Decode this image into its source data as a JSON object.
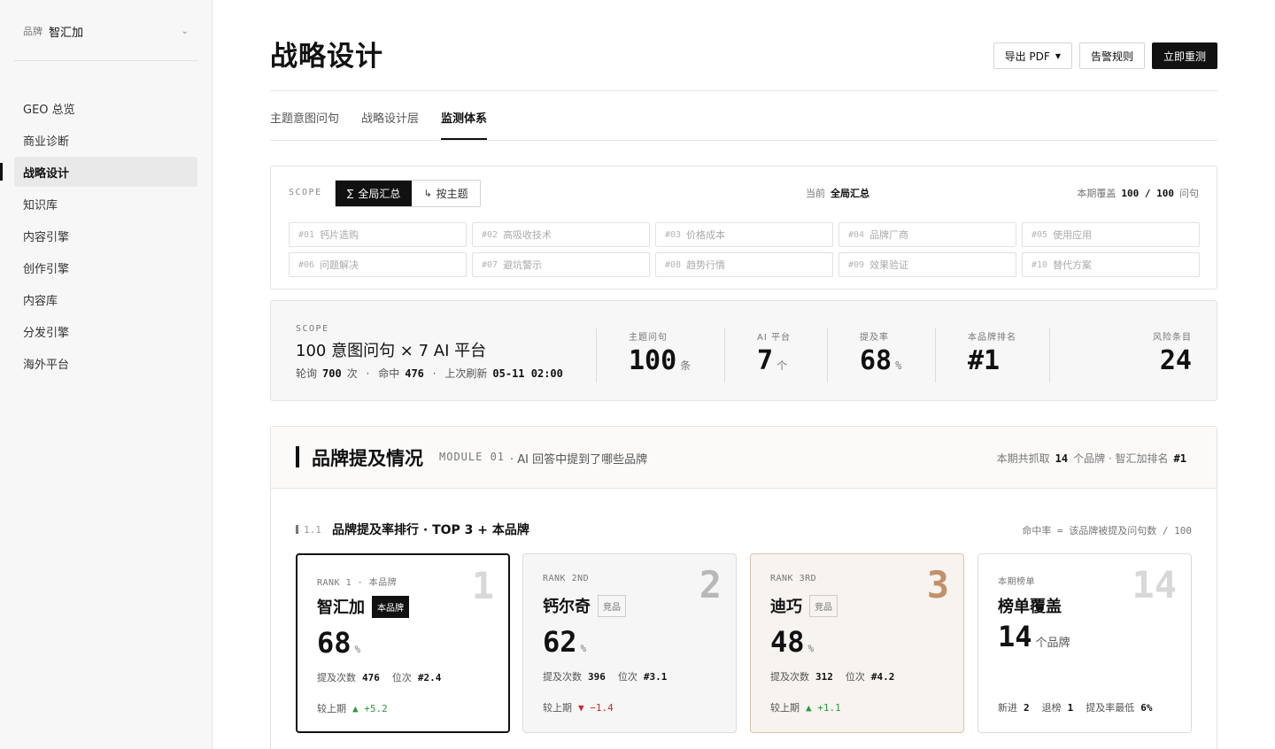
{
  "sidebar": {
    "brand_tag": "品牌",
    "brand_name": "智汇加",
    "items": [
      "GEO 总览",
      "商业诊断",
      "战略设计",
      "知识库",
      "内容引擎",
      "创作引擎",
      "内容库",
      "分发引擎",
      "海外平台"
    ],
    "active": "战略设计"
  },
  "header": {
    "title": "战略设计",
    "export_label": "导出 PDF",
    "alert_label": "告警规则",
    "retest_label": "立即重测"
  },
  "tabs": [
    "主题意图问句",
    "战略设计层",
    "监测体系"
  ],
  "active_tab": "监测体系",
  "scope": {
    "label": "SCOPE",
    "toggle_all": "全局汇总",
    "toggle_all_icon": "∑",
    "toggle_topic": "按主题",
    "toggle_topic_icon": "↳",
    "current_label": "当前",
    "current_value": "全局汇总",
    "coverage_label": "本期覆盖",
    "coverage_value": "100 / 100",
    "coverage_unit": "问句",
    "topics": [
      {
        "num": "#01",
        "name": "钙片选购"
      },
      {
        "num": "#02",
        "name": "高吸收技术"
      },
      {
        "num": "#03",
        "name": "价格成本"
      },
      {
        "num": "#04",
        "name": "品牌厂商"
      },
      {
        "num": "#05",
        "name": "使用应用"
      },
      {
        "num": "#06",
        "name": "问题解决"
      },
      {
        "num": "#07",
        "name": "避坑警示"
      },
      {
        "num": "#08",
        "name": "趋势行情"
      },
      {
        "num": "#09",
        "name": "效果验证"
      },
      {
        "num": "#10",
        "name": "替代方案"
      }
    ]
  },
  "summary": {
    "scope_label": "SCOPE",
    "title": "100 意图问句 × 7 AI 平台",
    "meta_poll_label": "轮询",
    "meta_poll_value": "700",
    "meta_poll_unit": "次",
    "meta_hit_label": "命中",
    "meta_hit_value": "476",
    "meta_refresh_label": "上次刷新",
    "meta_refresh_value": "05-11 02:00",
    "sep": "·",
    "stats": [
      {
        "label": "主题问句",
        "value": "100",
        "unit": "条"
      },
      {
        "label": "AI 平台",
        "value": "7",
        "unit": "个"
      },
      {
        "label": "提及率",
        "value": "68",
        "unit": "%"
      },
      {
        "label": "本品牌排名",
        "value": "#1",
        "unit": ""
      },
      {
        "label": "风险条目",
        "value": "24",
        "unit": ""
      }
    ]
  },
  "module": {
    "title": "品牌提及情况",
    "code": "MODULE 01",
    "desc": "· AI 回答中提到了哪些品牌",
    "right_prefix": "本期共抓取",
    "right_count": "14",
    "right_mid": "个品牌 · 智汇加排名",
    "right_rank": "#1",
    "sub_num": "1.1",
    "sub_title": "品牌提及率排行 · TOP 3 + 本品牌",
    "sub_note": "命中率 = 该品牌被提及问句数 / 100",
    "cards": [
      {
        "rank_label": "RANK 1 · 本品牌",
        "big": "1",
        "name": "智汇加",
        "tag": "本品牌",
        "pct": "68",
        "pct_unit": "%",
        "count_label": "提及次数",
        "count": "476",
        "pos_label": "位次",
        "pos": "#2.4",
        "delta_label": "较上期",
        "delta": "▲ +5.2",
        "delta_dir": "up"
      },
      {
        "rank_label": "RANK 2ND",
        "big": "2",
        "name": "钙尔奇",
        "tag": "竞品",
        "pct": "62",
        "pct_unit": "%",
        "count_label": "提及次数",
        "count": "396",
        "pos_label": "位次",
        "pos": "#3.1",
        "delta_label": "较上期",
        "delta": "▼ −1.4",
        "delta_dir": "down"
      },
      {
        "rank_label": "RANK 3RD",
        "big": "3",
        "name": "迪巧",
        "tag": "竞品",
        "pct": "48",
        "pct_unit": "%",
        "count_label": "提及次数",
        "count": "312",
        "pos_label": "位次",
        "pos": "#4.2",
        "delta_label": "较上期",
        "delta": "▲ +1.1",
        "delta_dir": "up"
      }
    ],
    "board": {
      "label": "本期榜单",
      "big": "14",
      "title": "榜单覆盖",
      "value": "14",
      "unit": "个品牌",
      "new_label": "新进",
      "new_value": "2",
      "out_label": "退榜",
      "out_value": "1",
      "min_label": "提及率最低",
      "min_value": "6%"
    }
  }
}
